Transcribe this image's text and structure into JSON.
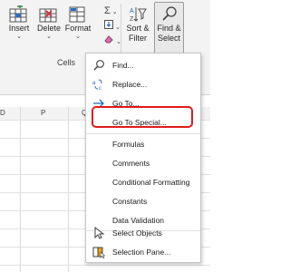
{
  "ribbon": {
    "insert_label": "Insert",
    "delete_label": "Delete",
    "format_label": "Format",
    "sort_label_1": "Sort &",
    "sort_label_2": "Filter",
    "find_label_1": "Find &",
    "find_label_2": "Select",
    "cells_group_label": "Cells"
  },
  "sheet": {
    "columns": [
      "D",
      "P",
      "Q"
    ]
  },
  "menu": {
    "items": [
      {
        "label": "Find...",
        "icon": "search-icon"
      },
      {
        "label": "Replace...",
        "icon": "replace-icon"
      },
      {
        "label": "Go To...",
        "icon": "goto-arrow-icon"
      },
      {
        "label": "Go To Special...",
        "icon": ""
      },
      {
        "label": "Formulas",
        "icon": ""
      },
      {
        "label": "Comments",
        "icon": ""
      },
      {
        "label": "Conditional Formatting",
        "icon": ""
      },
      {
        "label": "Constants",
        "icon": ""
      },
      {
        "label": "Data Validation",
        "icon": ""
      },
      {
        "label": "Select Objects",
        "icon": "pointer-icon"
      },
      {
        "label": "Selection Pane...",
        "icon": "selection-pane-icon"
      }
    ]
  },
  "colors": {
    "highlight": "#e01b1b",
    "ribbon_bg": "#f3f3f3",
    "goto_arrow": "#2b6cc4"
  }
}
